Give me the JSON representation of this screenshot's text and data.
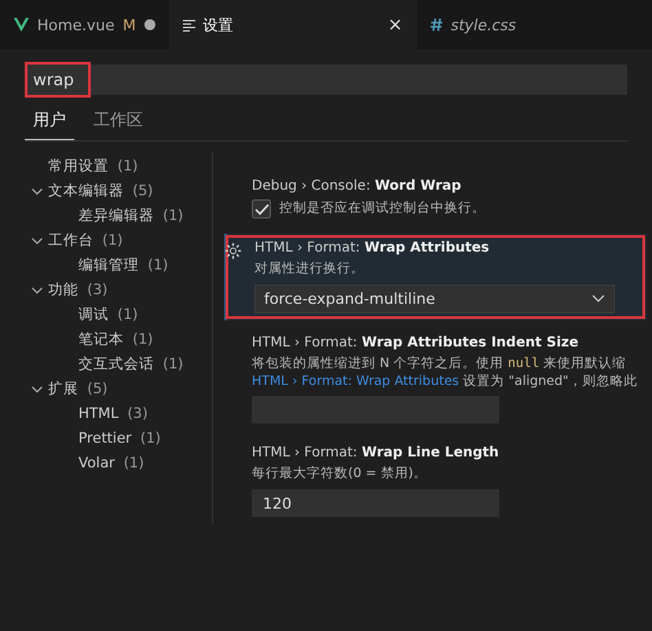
{
  "tabs": [
    {
      "kind": "vue",
      "label": "Home.vue",
      "badge": "M",
      "modified": true,
      "selected": false,
      "italic": false
    },
    {
      "kind": "settings",
      "label": "设置",
      "close": "×",
      "modified": false,
      "selected": true,
      "italic": false
    },
    {
      "kind": "css",
      "label": "style.css",
      "modified": false,
      "selected": false,
      "italic": true
    }
  ],
  "search": {
    "value": "wrap",
    "highlighted": true
  },
  "scopes": [
    {
      "label": "用户",
      "selected": true
    },
    {
      "label": "工作区",
      "selected": false
    }
  ],
  "tree": [
    {
      "label": "常用设置",
      "count": "(1)"
    },
    {
      "label": "文本编辑器",
      "count": "(5)",
      "expanded": true,
      "children": [
        {
          "label": "差异编辑器",
          "count": "(1)"
        }
      ]
    },
    {
      "label": "工作台",
      "count": "(1)",
      "expanded": true,
      "children": [
        {
          "label": "编辑管理",
          "count": "(1)"
        }
      ]
    },
    {
      "label": "功能",
      "count": "(3)",
      "expanded": true,
      "children": [
        {
          "label": "调试",
          "count": "(1)"
        },
        {
          "label": "笔记本",
          "count": "(1)"
        },
        {
          "label": "交互式会话",
          "count": "(1)"
        }
      ]
    },
    {
      "label": "扩展",
      "count": "(5)",
      "expanded": true,
      "children": [
        {
          "label": "HTML",
          "count": "(3)"
        },
        {
          "label": "Prettier",
          "count": "(1)"
        },
        {
          "label": "Volar",
          "count": "(1)"
        }
      ]
    }
  ],
  "settings": [
    {
      "kind": "checkbox",
      "category": "Debug › Console: ",
      "name": "Word Wrap",
      "checked": true,
      "description": [
        {
          "kind": "text",
          "text": "控制是否应在调试控制台中换行。"
        }
      ],
      "focused": false,
      "highlighted": false
    },
    {
      "kind": "select",
      "category": "HTML › Format: ",
      "name": "Wrap Attributes",
      "description": [
        {
          "kind": "text",
          "text": "对属性进行换行。"
        }
      ],
      "value": "force-expand-multiline",
      "focused": true,
      "highlighted": true
    },
    {
      "kind": "number",
      "category": "HTML › Format: ",
      "name": "Wrap Attributes Indent Size",
      "description": [
        {
          "kind": "text",
          "text": "将包装的属性缩进到 N 个字符之后。使用 "
        },
        {
          "kind": "code",
          "text": "null"
        },
        {
          "kind": "text",
          "text": " 来使用默认缩"
        },
        {
          "kind": "link",
          "text": "HTML › Format: Wrap Attributes"
        },
        {
          "kind": "text",
          "text": " 设置为 \"aligned\"，则忽略此"
        }
      ],
      "focused": false,
      "highlighted": false
    },
    {
      "kind": "number",
      "category": "HTML › Format: ",
      "name": "Wrap Line Length",
      "description": [
        {
          "kind": "text",
          "text": "每行最大字符数(0 = 禁用)。"
        }
      ],
      "value": "120",
      "focused": false,
      "highlighted": false
    }
  ]
}
